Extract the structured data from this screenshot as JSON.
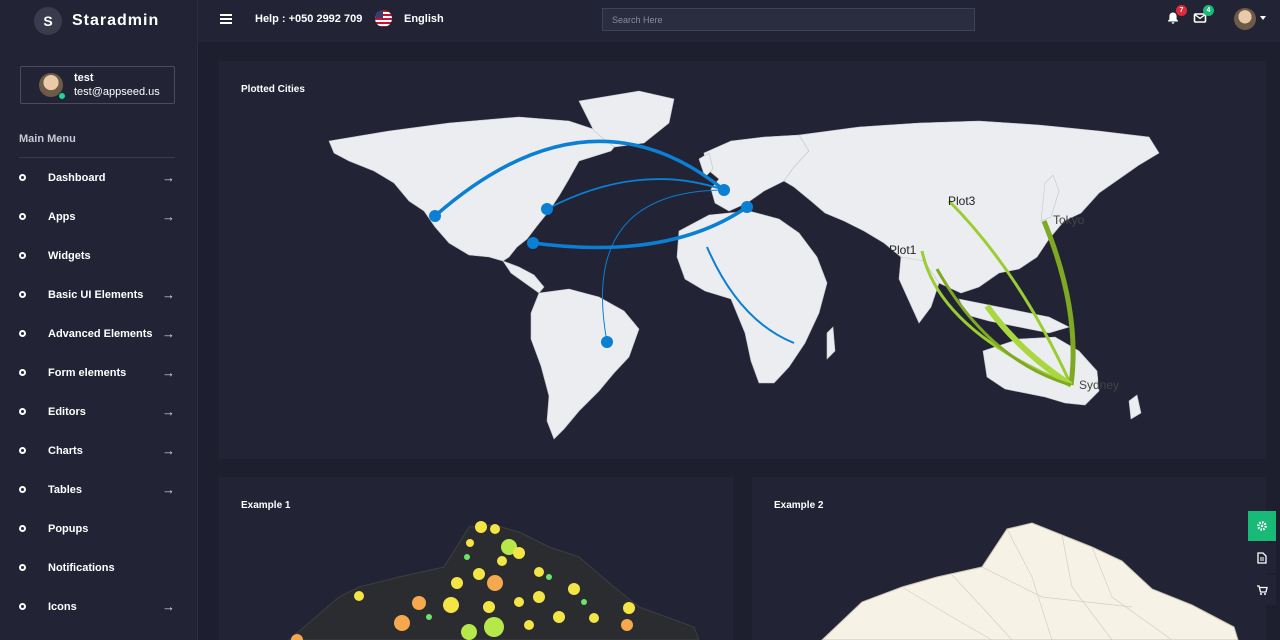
{
  "brand": {
    "initial": "S",
    "name": "Staradmin"
  },
  "profile": {
    "name": "test",
    "email": "test@appseed.us"
  },
  "sidebar": {
    "menu_title": "Main Menu",
    "items": [
      {
        "label": "Dashboard",
        "has_arrow": true
      },
      {
        "label": "Apps",
        "has_arrow": true
      },
      {
        "label": "Widgets",
        "has_arrow": false
      },
      {
        "label": "Basic UI Elements",
        "has_arrow": true
      },
      {
        "label": "Advanced Elements",
        "has_arrow": true
      },
      {
        "label": "Form elements",
        "has_arrow": true
      },
      {
        "label": "Editors",
        "has_arrow": true
      },
      {
        "label": "Charts",
        "has_arrow": true
      },
      {
        "label": "Tables",
        "has_arrow": true
      },
      {
        "label": "Popups",
        "has_arrow": false
      },
      {
        "label": "Notifications",
        "has_arrow": false
      },
      {
        "label": "Icons",
        "has_arrow": true
      }
    ],
    "arrow_glyph": "→"
  },
  "topbar": {
    "help": "Help : +050 2992 709",
    "language": "English",
    "search_placeholder": "Search Here",
    "notifications_count": "7",
    "messages_count": "4"
  },
  "cards": {
    "map_main": {
      "title": "Plotted Cities"
    },
    "example1": {
      "title": "Example 1"
    },
    "example2": {
      "title": "Example 2"
    }
  },
  "map_labels": {
    "plot3": "Plot3",
    "plot1": "Plot1",
    "tokyo": "Tokyo",
    "sydney": "Sydney"
  },
  "colors": {
    "accent_blue": "#0a7fd3",
    "green_route": "#9acd32",
    "badge_red": "#e02a3a",
    "badge_green": "#19b978",
    "settings_green": "#19b978"
  }
}
